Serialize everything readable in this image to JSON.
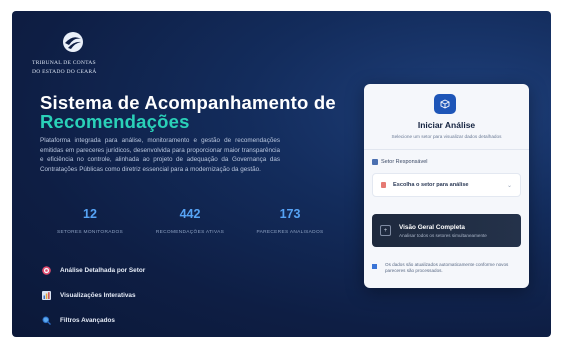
{
  "logo": {
    "line1": "TRIBUNAL DE CONTAS",
    "line2": "DO ESTADO DO CEARÁ"
  },
  "hero": {
    "title": "Sistema de Acompanhamento de",
    "title_accent": "Recomendações",
    "description": "Plataforma integrada para análise, monitoramento e gestão de recomendações emitidas em pareceres jurídicos, desenvolvida para proporcionar maior transparência e eficiência no controle, alinhada ao projeto de adequação da Governança das Contratações Públicas como diretriz essencial para a modernização da gestão."
  },
  "stats": [
    {
      "value": "12",
      "label": "SETORES MONITORADOS"
    },
    {
      "value": "442",
      "label": "RECOMENDAÇÕES ATIVAS"
    },
    {
      "value": "173",
      "label": "PARECERES ANALISADOS"
    }
  ],
  "features": [
    {
      "label": "Análise Detalhada por Setor",
      "icon": "target-icon"
    },
    {
      "label": "Visualizações Interativas",
      "icon": "bar-chart-icon"
    },
    {
      "label": "Filtros Avançados",
      "icon": "search-icon"
    }
  ],
  "card": {
    "title": "Iniciar Análise",
    "subtitle": "Selecione um setor para visualizar dados detalhados",
    "sector_label": "Setor Responsável",
    "select_value": "Escolha o setor para análise",
    "overview_title": "Visão Geral Completa",
    "overview_sub": "Analisar todos os setores simultaneamente",
    "info": "Os dados são atualizados automaticamente conforme novos pareceres são processados."
  },
  "colors": {
    "accent": "#2ad1b8",
    "stat_blue": "#56a3f5",
    "primary": "#1e56b8"
  }
}
